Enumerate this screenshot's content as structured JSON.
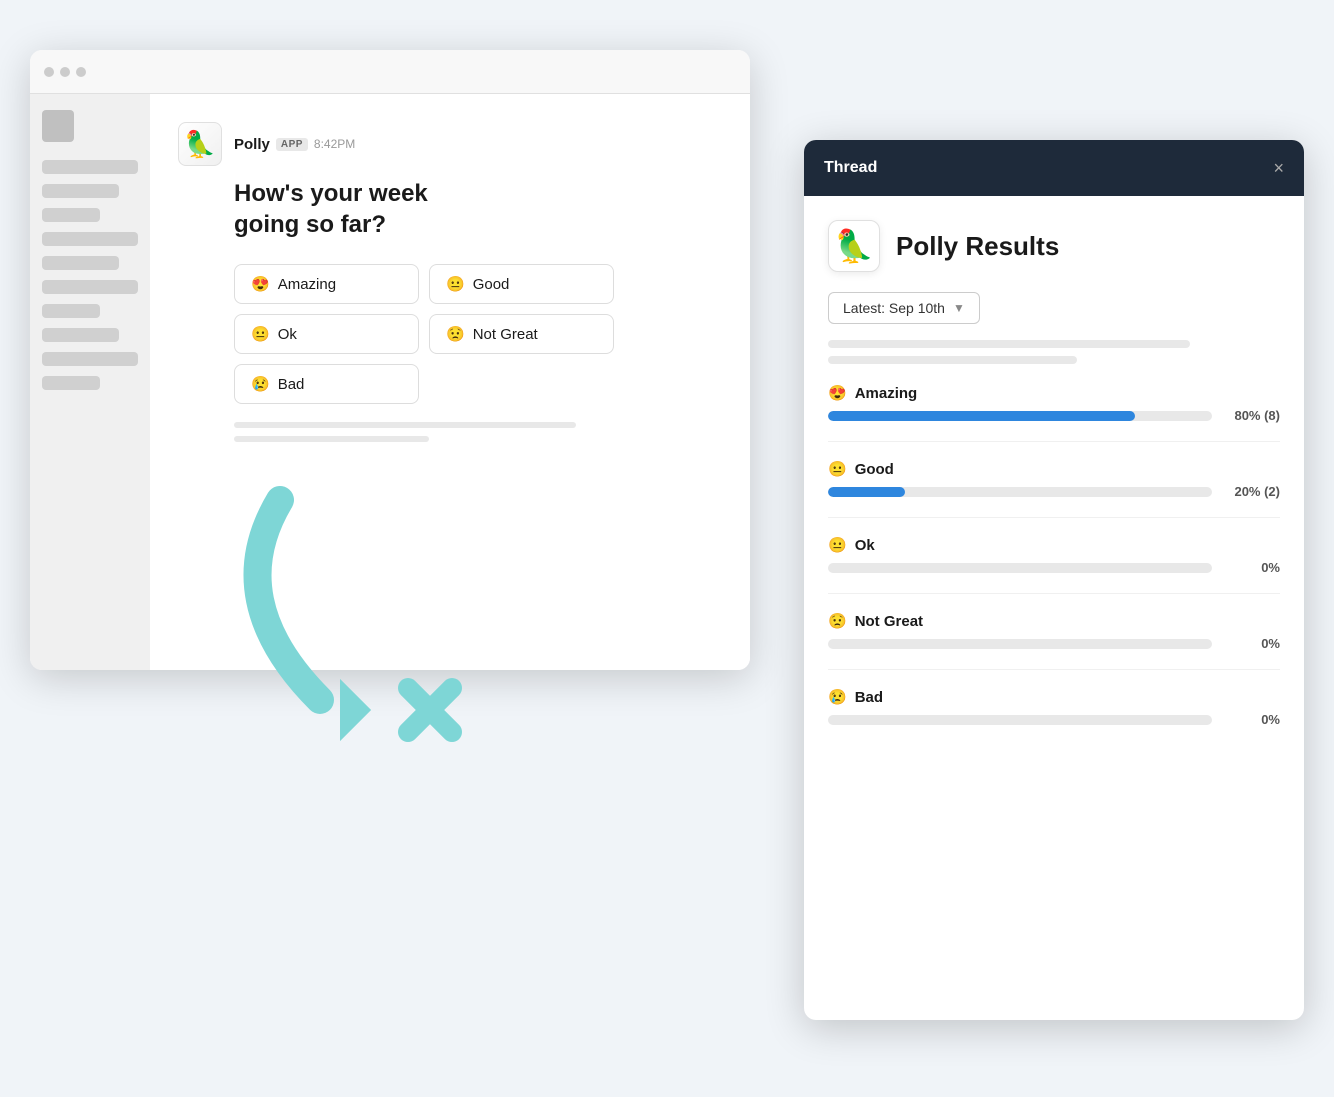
{
  "slack_window": {
    "dots": [
      "dot1",
      "dot2",
      "dot3"
    ],
    "polly": {
      "logo_emoji": "🦜",
      "name": "Polly",
      "app_badge": "APP",
      "time": "8:42PM",
      "question": "How's your week\ngoing so far?",
      "options": [
        {
          "emoji": "😍",
          "label": "Amazing"
        },
        {
          "emoji": "😐",
          "label": "Good"
        },
        {
          "emoji": "😐",
          "label": "Ok"
        },
        {
          "emoji": "😟",
          "label": "Not Great"
        },
        {
          "emoji": "😢",
          "label": "Bad"
        }
      ]
    }
  },
  "thread_panel": {
    "header": {
      "title": "Thread",
      "close_label": "×"
    },
    "polly_logo": "🦜",
    "polly_title": "Polly Results",
    "date_selector": {
      "label": "Latest: Sep 10th",
      "chevron": "▼"
    },
    "results": [
      {
        "emoji": "😍",
        "label": "Amazing",
        "pct": 80,
        "display": "80% (8)"
      },
      {
        "emoji": "😐",
        "label": "Good",
        "pct": 20,
        "display": "20% (2)"
      },
      {
        "emoji": "😐",
        "label": "Ok",
        "pct": 0,
        "display": "0%"
      },
      {
        "emoji": "😟",
        "label": "Not Great",
        "pct": 0,
        "display": "0%"
      },
      {
        "emoji": "😢",
        "label": "Bad",
        "pct": 0,
        "display": "0%"
      }
    ]
  },
  "arrow": {
    "color": "#7ed6d6"
  }
}
